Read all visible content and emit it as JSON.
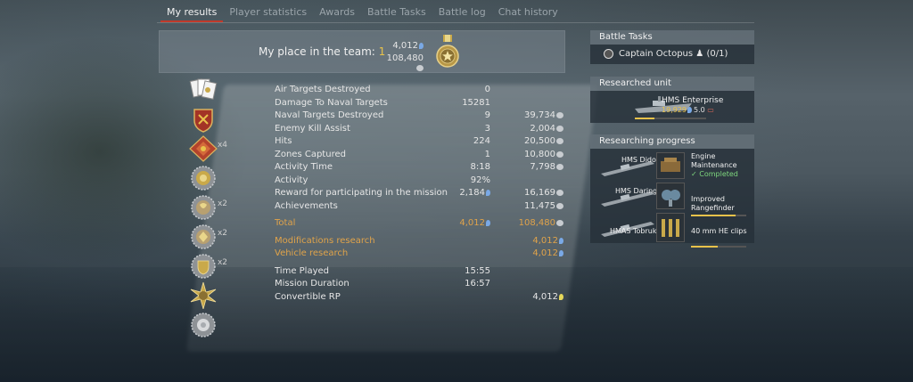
{
  "tabs": [
    {
      "label": "My results"
    },
    {
      "label": "Player statistics"
    },
    {
      "label": "Awards"
    },
    {
      "label": "Battle Tasks"
    },
    {
      "label": "Battle log"
    },
    {
      "label": "Chat history"
    }
  ],
  "place": {
    "label": "My place in the team:",
    "value": "1",
    "rp": "4,012",
    "sl": "108,480"
  },
  "medals": [
    {
      "icon": "cards-icon",
      "mult": ""
    },
    {
      "icon": "shield-medal-icon",
      "mult": ""
    },
    {
      "icon": "red-cross-medal-icon",
      "mult": "x4"
    },
    {
      "icon": "gold-ring-medal-icon",
      "mult": ""
    },
    {
      "icon": "silver-ring-medal-icon",
      "mult": "x2"
    },
    {
      "icon": "silver-ring-medal-icon",
      "mult": "x2"
    },
    {
      "icon": "shield-gold-medal-icon",
      "mult": "x2"
    },
    {
      "icon": "sun-medal-icon",
      "mult": ""
    },
    {
      "icon": "white-medal-icon",
      "mult": ""
    }
  ],
  "stats": [
    {
      "label": "Air Targets Destroyed",
      "v1": "0",
      "v2": "",
      "v2icon": ""
    },
    {
      "label": "Damage To Naval Targets",
      "v1": "15281",
      "v2": "",
      "v2icon": ""
    },
    {
      "label": "Naval Targets Destroyed",
      "v1": "9",
      "v2": "39,734",
      "v2icon": "sl"
    },
    {
      "label": "Enemy Kill Assist",
      "v1": "3",
      "v2": "2,004",
      "v2icon": "sl"
    },
    {
      "label": "Hits",
      "v1": "224",
      "v2": "20,500",
      "v2icon": "sl"
    },
    {
      "label": "Zones Captured",
      "v1": "1",
      "v2": "10,800",
      "v2icon": "sl"
    },
    {
      "label": "Activity Time",
      "v1": "8:18",
      "v2": "7,798",
      "v2icon": "sl"
    },
    {
      "label": "Activity",
      "v1": "92%",
      "v2": "",
      "v2icon": ""
    },
    {
      "label": "Reward for participating in the mission",
      "v1": "2,184",
      "v1icon": "rp",
      "v2": "16,169",
      "v2icon": "sl"
    },
    {
      "label": "Achievements",
      "v1": "",
      "v2": "11,475",
      "v2icon": "sl"
    }
  ],
  "total": {
    "label": "Total",
    "rp": "4,012",
    "sl": "108,480"
  },
  "research": [
    {
      "label": "Modifications research",
      "value": "4,012"
    },
    {
      "label": "Vehicle research",
      "value": "4,012"
    }
  ],
  "time": [
    {
      "label": "Time Played",
      "v1": "15:55",
      "v2": ""
    },
    {
      "label": "Mission Duration",
      "v1": "16:57",
      "v2": ""
    },
    {
      "label": "Convertible RP",
      "v1": "",
      "v2": "4,012"
    }
  ],
  "battle_tasks": {
    "title": "Battle Tasks",
    "task": "Captain Octopus",
    "progress": "(0/1)"
  },
  "researched_unit": {
    "title": "Researched unit",
    "name": "HMS Enterprise",
    "rp": "19,929",
    "br": "5.0",
    "progress": 0.28
  },
  "researching": {
    "title": "Researching progress",
    "items": [
      {
        "ship": "HMS Dido",
        "mod": "Engine Maintenance",
        "status": "Completed",
        "progress": 1.0
      },
      {
        "ship": "HMS Daring",
        "mod": "Improved Rangefinder",
        "status": "",
        "progress": 0.8
      },
      {
        "ship": "HMAS Tobruk",
        "mod": "40 mm HE clips",
        "status": "",
        "progress": 0.48
      }
    ]
  },
  "colors": {
    "accent": "#c0392b",
    "gold": "#e0a34a",
    "rp": "#7aa9e6",
    "completed": "#7ed67e"
  }
}
